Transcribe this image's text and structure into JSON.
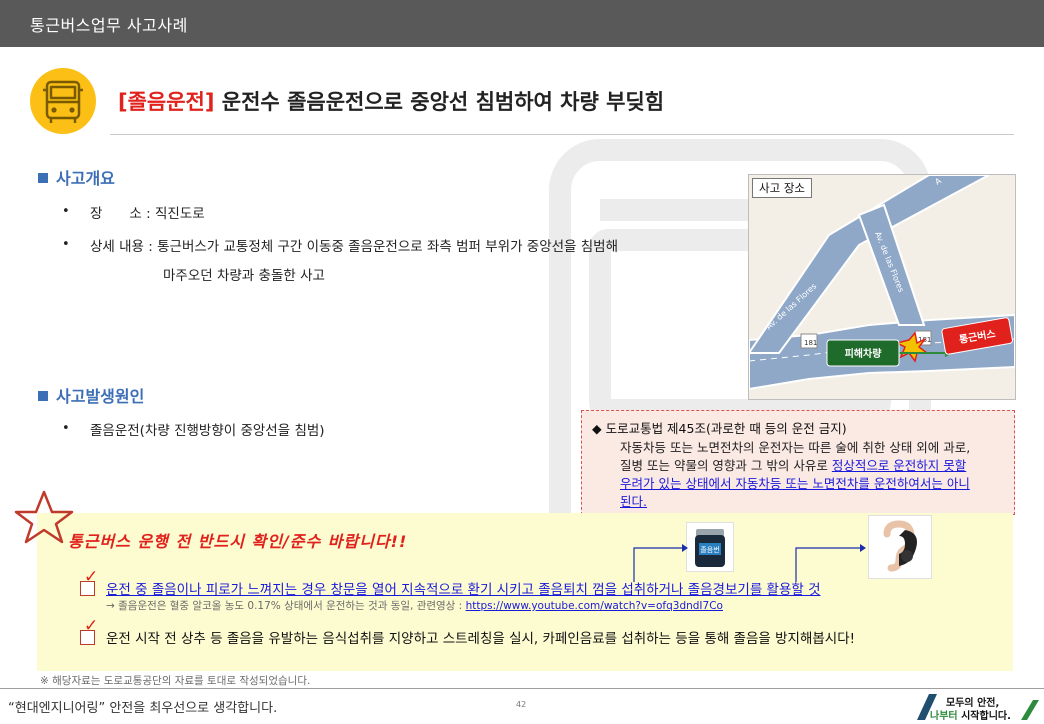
{
  "header": {
    "title": "통근버스업무 사고사례"
  },
  "title": {
    "tag": "[졸음운전]",
    "text": " 운전수 졸음운전으로 중앙선 침범하여 차량 부딪힘"
  },
  "overview": {
    "heading": "사고개요",
    "place_label": "장　　소 : ",
    "place_value": "직진도로",
    "detail_label": "상세 내용 : ",
    "detail_line1": "통근버스가 교통정체 구간 이동중 졸음운전으로 좌측 범퍼 부위가 중앙선을 침범해",
    "detail_line2": "마주오던 차량과 충돌한 사고"
  },
  "cause": {
    "heading": "사고발생원인",
    "item": "졸음운전(차량 진행방향이 중앙선을 침범)"
  },
  "map": {
    "label": "사고 장소",
    "road1": "Av. de las Flores",
    "road2": "Av. de las Flores",
    "road_corner": "A",
    "route_left": "181",
    "route_right": "181",
    "victim": "피해차량",
    "bus": "통근버스"
  },
  "law": {
    "title": "◆ 도로교통법 제45조(과로한 때 등의 운전 금지)",
    "line1": "자동차등 또는 노면전차의 운전자는 따른 술에 취한 상태 외에 과로,",
    "line2_plain": "질병 또는 약물의 영향과 그 밖의 사유로 ",
    "line2_link": "정상적으로 운전하지 못할",
    "line3": "우려가 있는 상태에서 자동차등 또는 노면전차를 운전하여서는 아니",
    "line4": "된다."
  },
  "notice": {
    "heading": "통근버스 운행 전 반드시 확인/준수 바랍니다!!",
    "tip1": "운전 중 졸음이나 피로가 느껴지는 경우 창문을 열어 지속적으로 환기 시키고 졸음퇴치 껌을 섭취하거나 졸음경보기를 활용할 것",
    "tip1_sub": "→ 졸음운전은 혈중 알코올 농도 0.17% 상태에서 운전하는 것과 동일, 관련영상 : ",
    "tip1_url": "https://www.youtube.com/watch?v=ofq3dndI7Co",
    "gum_label": "졸음번",
    "tip2": "운전 시작 전 상추 등 졸음을 유발하는 음식섭취를 지양하고 스트레칭을 실시, 카페인음료를 섭취하는 등을 통해 졸음을 방지해봅시다!"
  },
  "footnote": "※ 해당자료는 도로교통공단의 자료를 토대로 작성되었습니다.",
  "footer": {
    "slogan": "“현대엔지니어링” 안전을 최우선으로 생각합니다.",
    "page": "42",
    "logo_line1": "모두의 안전,",
    "logo_line2_green": "나부터",
    "logo_line2_rest": " 시작합니다."
  },
  "colors": {
    "header": "#595959",
    "accent_blue": "#3d6fb6",
    "accent_red": "#e0211c",
    "icon_yellow": "#fbbf16",
    "notice_bg": "#fdfbd0",
    "law_bg": "#fbe9e4"
  }
}
